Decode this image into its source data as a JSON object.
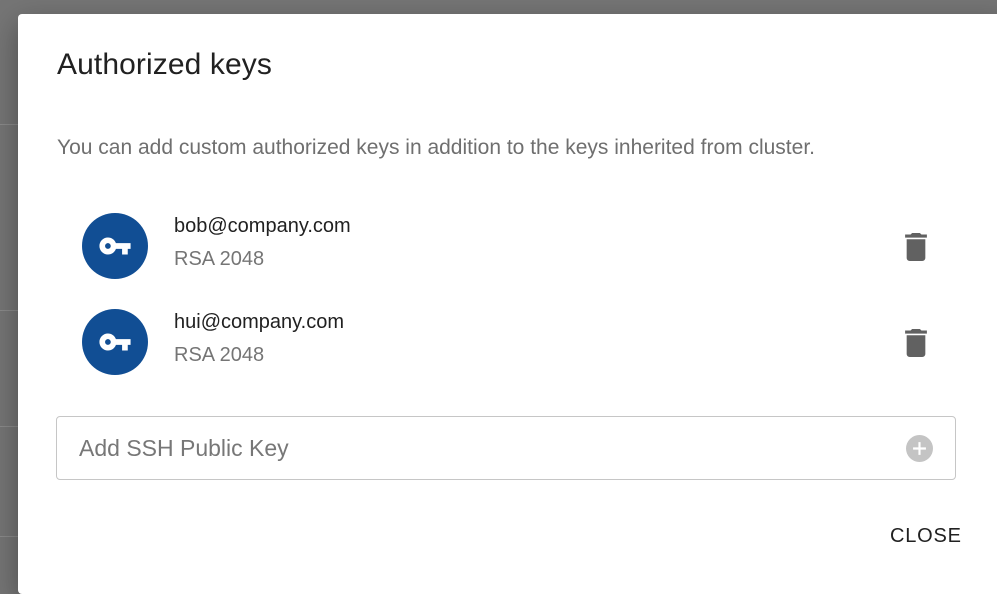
{
  "dialog": {
    "title": "Authorized keys",
    "description": "You can add custom authorized keys in addition to the keys inherited from cluster."
  },
  "keys": [
    {
      "email": "bob@company.com",
      "type": "RSA 2048",
      "icon": "key-icon",
      "delete_icon": "trash-icon"
    },
    {
      "email": "hui@company.com",
      "type": "RSA 2048",
      "icon": "key-icon",
      "delete_icon": "trash-icon"
    }
  ],
  "add_key": {
    "placeholder": "Add SSH Public Key",
    "icon": "add-circle-icon"
  },
  "actions": {
    "close_label": "CLOSE"
  },
  "colors": {
    "avatar_background": "#114e94",
    "backdrop": "#757575",
    "add_icon": "#c4c4c4",
    "delete_icon": "#616161"
  }
}
